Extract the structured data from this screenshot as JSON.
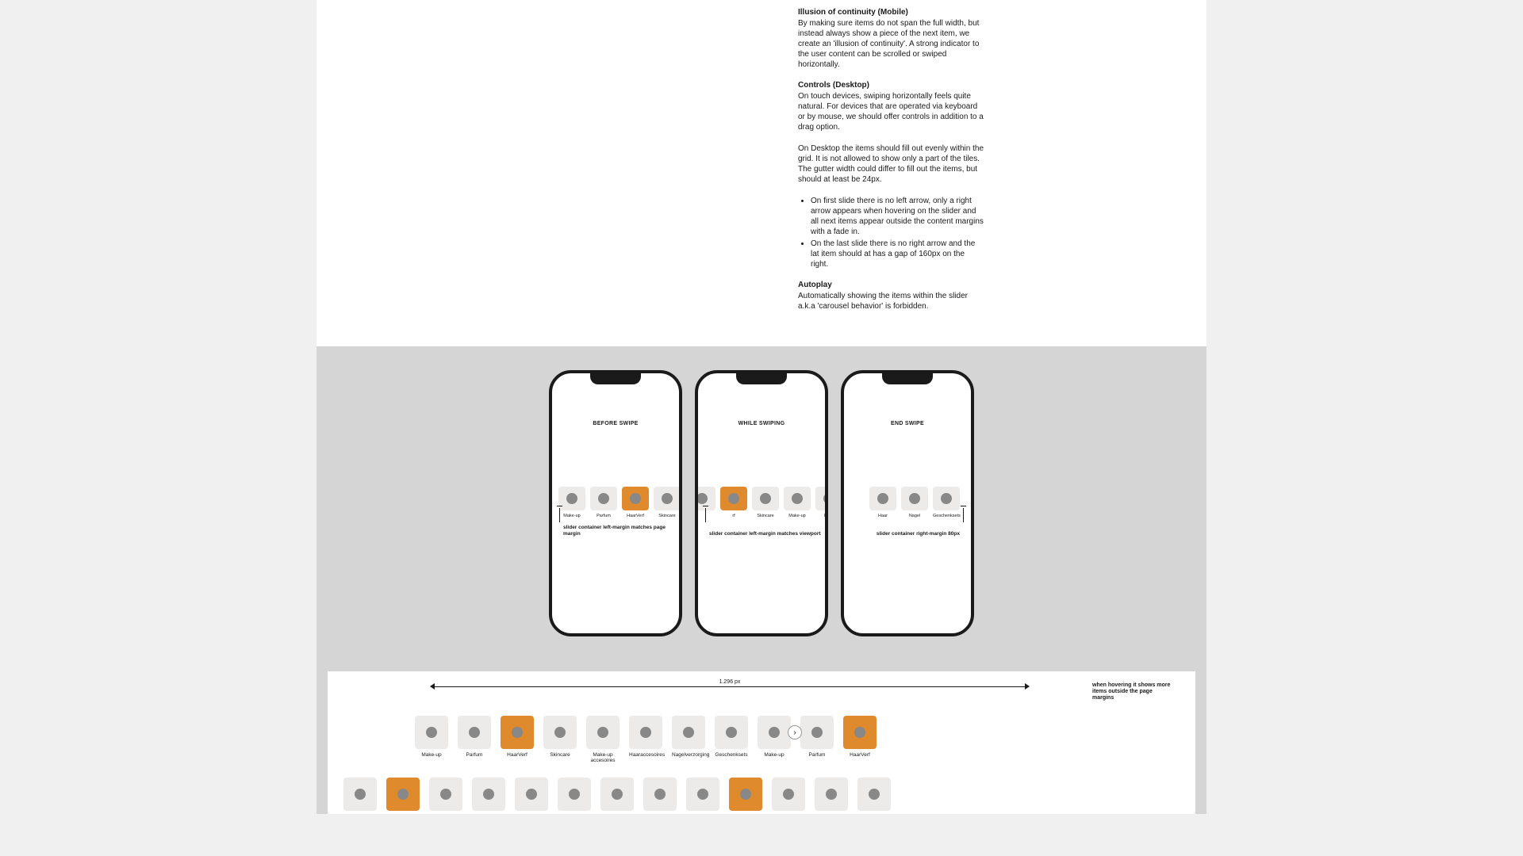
{
  "sections": {
    "illusion": {
      "heading": "Illusion of continuity (Mobile)",
      "body": "By making sure items do not span the full width, but instead always show a piece of the next item, we create an 'illusion of continuity'. A strong indicator to the user content can be scrolled or swiped horizontally."
    },
    "controls": {
      "heading": "Controls (Desktop)",
      "body1": "On touch devices, swiping horizontally feels quite natural. For devices that are operated via keyboard or by mouse, we should offer controls in addition to a drag option.",
      "body2": "On Desktop the items should fill out evenly within the grid. It is not allowed to show only a part of the tiles. The gutter width could differ to fill out the items, but should at least be 24px.",
      "bullets": [
        "On first slide there is no left arrow, only a right arrow appears when hovering on the slider and all next items appear outside the content margins with a fade in.",
        "On the last slide there is no right arrow and the lat item should at has a gap of 160px on the right."
      ]
    },
    "autoplay": {
      "heading": "Autoplay",
      "body": "Automatically showing the items within the slider a.k.a 'carousel behavior' is forbidden."
    }
  },
  "phones": [
    {
      "title": "BEFORE SWIPE",
      "note": "slider container left-margin matches page margin",
      "note_side": "left",
      "align": "align-start",
      "items": [
        {
          "label": "Make-up",
          "variant": ""
        },
        {
          "label": "Parfum",
          "variant": ""
        },
        {
          "label": "HaarVerf",
          "variant": "orange"
        },
        {
          "label": "Skincare",
          "variant": ""
        }
      ]
    },
    {
      "title": "WHILE SWIPING",
      "note": "slider container left-margin matches viewport",
      "note_side": "left",
      "align": "align-mid",
      "items": [
        {
          "label": "",
          "variant": ""
        },
        {
          "label": "rf",
          "variant": "orange"
        },
        {
          "label": "Skincare",
          "variant": ""
        },
        {
          "label": "Make-up",
          "variant": ""
        },
        {
          "label": "Haar",
          "variant": ""
        }
      ]
    },
    {
      "title": "END SWIPE",
      "note": "slider container right-margin 80px",
      "note_side": "right",
      "align": "align-end",
      "items": [
        {
          "label": "Haar",
          "variant": ""
        },
        {
          "label": "Nagel",
          "variant": ""
        },
        {
          "label": "Geschenksets",
          "variant": ""
        }
      ]
    }
  ],
  "desktop": {
    "width_label": "1.296 px",
    "hover_note": "when hovering it shows more items outside the page margins",
    "row1": [
      {
        "label": "Make-up",
        "variant": ""
      },
      {
        "label": "Parfum",
        "variant": ""
      },
      {
        "label": "HaarVerf",
        "variant": "orange"
      },
      {
        "label": "Skincare",
        "variant": ""
      },
      {
        "label": "Make-up accesoires",
        "variant": ""
      },
      {
        "label": "Haaraccesoires",
        "variant": ""
      },
      {
        "label": "Nagelverzorging",
        "variant": ""
      },
      {
        "label": "Geschenksets",
        "variant": ""
      },
      {
        "label": "Make-up",
        "variant": ""
      },
      {
        "label": "Parfum",
        "variant": ""
      },
      {
        "label": "HaarVerf",
        "variant": "orange"
      }
    ],
    "row2": [
      {
        "label": "",
        "variant": ""
      },
      {
        "label": "",
        "variant": "orange"
      },
      {
        "label": "",
        "variant": ""
      },
      {
        "label": "",
        "variant": ""
      },
      {
        "label": "",
        "variant": ""
      },
      {
        "label": "",
        "variant": ""
      },
      {
        "label": "",
        "variant": ""
      },
      {
        "label": "",
        "variant": ""
      },
      {
        "label": "",
        "variant": ""
      },
      {
        "label": "",
        "variant": "orange"
      },
      {
        "label": "",
        "variant": ""
      },
      {
        "label": "",
        "variant": ""
      },
      {
        "label": "",
        "variant": ""
      }
    ]
  }
}
